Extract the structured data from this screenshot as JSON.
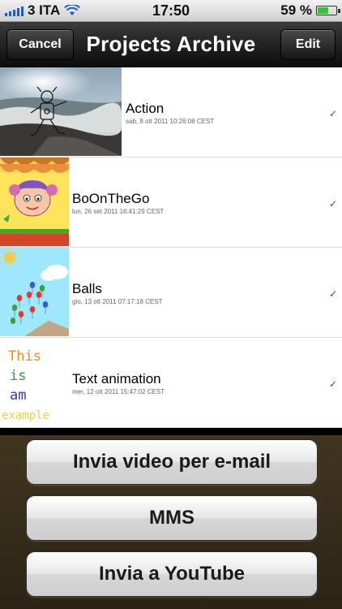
{
  "status_bar": {
    "carrier": "3 ITA",
    "time": "17:50",
    "battery_percent": "59 %",
    "battery_level": 0.59
  },
  "nav": {
    "cancel_label": "Cancel",
    "title": "Projects Archive",
    "edit_label": "Edit"
  },
  "projects": [
    {
      "title": "Action",
      "date": "sab, 8 ott 2011 10:26:08 CEST",
      "checked": true
    },
    {
      "title": "BoOnTheGo",
      "date": "lun, 26 set 2011 16:41:29 CEST",
      "checked": true
    },
    {
      "title": "Balls",
      "date": "gio, 13 ott 2011 07:17:18 CEST",
      "checked": true
    },
    {
      "title": "Text animation",
      "date": "mer, 12 ott 2011 15:47:02 CEST",
      "checked": true
    }
  ],
  "thumb_text": [
    "This",
    "is",
    "am",
    "example"
  ],
  "check_glyph": "✓",
  "action_sheet": {
    "email_label": "Invia video per e-mail",
    "mms_label": "MMS",
    "youtube_label": "Invia a YouTube"
  }
}
